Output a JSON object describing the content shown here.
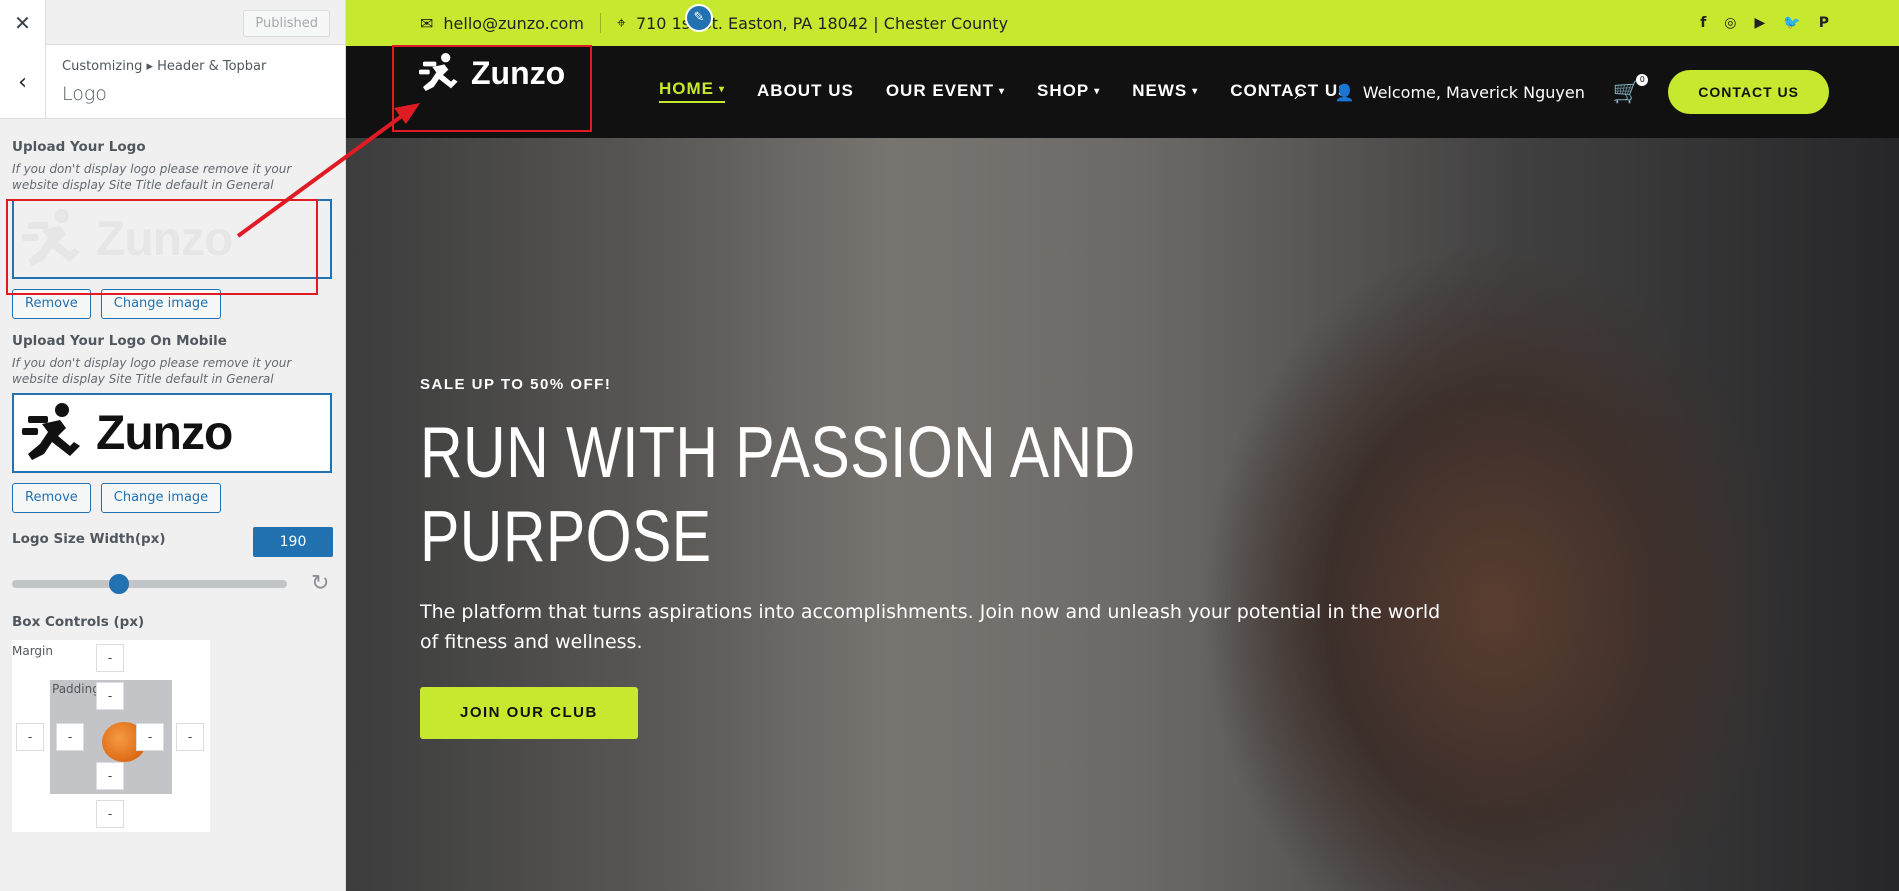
{
  "sidebar": {
    "close_icon": "close-icon",
    "published_label": "Published",
    "breadcrumb": "Customizing ▸ Header & Topbar",
    "title": "Logo",
    "upload_logo": {
      "label": "Upload Your Logo",
      "description": "If you don't display logo please remove it your website display Site Title default in General",
      "remove_label": "Remove",
      "change_label": "Change image",
      "preview_text": "Zunzo"
    },
    "upload_logo_mobile": {
      "label": "Upload Your Logo On Mobile",
      "description": "If you don't display logo please remove it your website display Site Title default in General",
      "remove_label": "Remove",
      "change_label": "Change image",
      "preview_text": "Zunzo"
    },
    "logo_size": {
      "label": "Logo Size Width(px)",
      "value": "190",
      "slider_fraction": 0.38
    },
    "box_controls": {
      "label": "Box Controls (px)",
      "margin_label": "Margin",
      "padding_label": "Padding",
      "margin_top": "-",
      "margin_right": "-",
      "margin_bottom": "-",
      "margin_left": "-",
      "padding_top": "-",
      "padding_right": "-",
      "padding_bottom": "-",
      "padding_left": "-"
    }
  },
  "topbar": {
    "email": "hello@zunzo.com",
    "address": "710 1st St. Easton, PA 18042 | Chester County",
    "social": [
      "f",
      "◎",
      "▶",
      "🐦",
      "P"
    ]
  },
  "nav": {
    "logo_text": "Zunzo",
    "items": [
      {
        "label": "HOME",
        "has_dropdown": true,
        "active": true
      },
      {
        "label": "ABOUT US",
        "has_dropdown": false
      },
      {
        "label": "OUR EVENT",
        "has_dropdown": true
      },
      {
        "label": "SHOP",
        "has_dropdown": true
      },
      {
        "label": "NEWS",
        "has_dropdown": true
      },
      {
        "label": "CONTACT US",
        "has_dropdown": false
      }
    ],
    "welcome": "Welcome, Maverick Nguyen",
    "cart_count": "0",
    "cta": "CONTACT US"
  },
  "hero": {
    "eyebrow": "SALE UP TO 50% OFF!",
    "heading_line1": "RUN WITH PASSION AND",
    "heading_line2": "PURPOSE",
    "subtext": "The platform that turns aspirations into accomplishments. Join now and unleash your potential in the world of fitness and wellness.",
    "cta": "JOIN OUR CLUB"
  },
  "colors": {
    "accent": "#c6e92f",
    "nav_bg": "#111111",
    "wp_blue": "#2271b1",
    "annotation_red": "#e01b24"
  }
}
